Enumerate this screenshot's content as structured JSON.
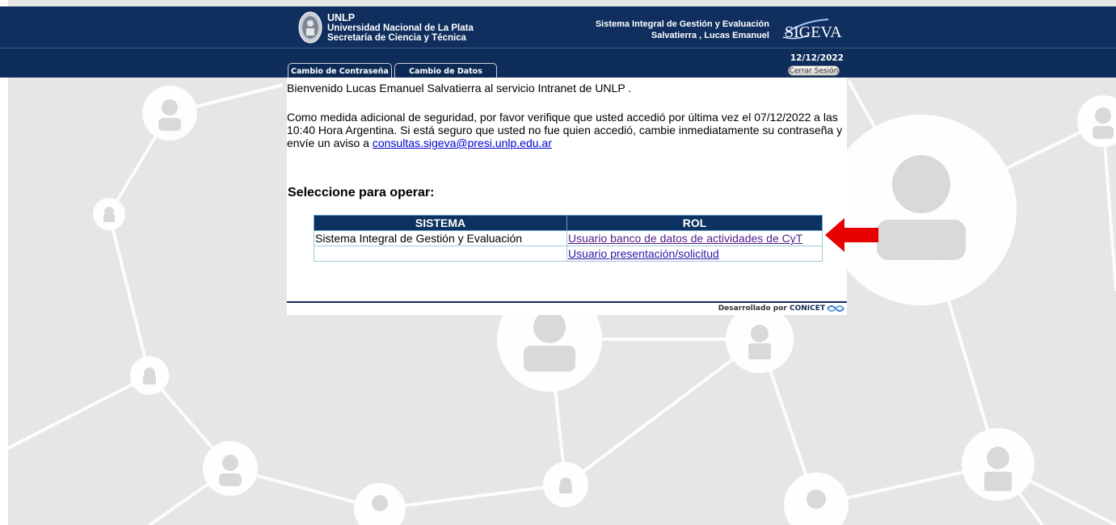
{
  "header": {
    "inst_abbr": "UNLP",
    "inst_name": "Universidad Nacional de La Plata",
    "inst_dept": "Secretaría de Ciencia y Técnica",
    "system_name": "Sistema Integral de Gestión y Evaluación",
    "user_name": "Salvatierra , Lucas Emanuel",
    "brand_logo_text": "SIGEVA",
    "date": "12/12/2022"
  },
  "nav": {
    "tabs": [
      {
        "label": "Cambio de Contraseña"
      },
      {
        "label": "Cambio de Datos"
      }
    ],
    "logout_label": "Cerrar Sesión"
  },
  "main": {
    "welcome": "Bienvenido Lucas Emanuel Salvatierra al servicio Intranet de UNLP .",
    "security_note": "Como medida adicional de seguridad, por favor verifique que usted accedió por última vez el 07/12/2022 a las 10:40 Hora Argentina. Si está seguro que usted no fue quien accedió, cambie inmediatamente su contraseña y envíe un aviso a",
    "contact_email": "consultas.sigeva@presi.unlp.edu.ar",
    "select_heading": "Seleccione para operar:",
    "table": {
      "headers": [
        "SISTEMA",
        "ROL"
      ],
      "rows": [
        {
          "system": "Sistema Integral de Gestión y Evaluación",
          "role": "Usuario banco de datos de actividades de CyT"
        },
        {
          "system": "",
          "role": "Usuario presentación/solicitud"
        }
      ]
    }
  },
  "footer": {
    "developed_by": "Desarrollado por",
    "org": "CONICET"
  },
  "colors": {
    "header_bg": "#102f5e",
    "table_header_bg": "#0b3260",
    "link": "#2a1aa8",
    "annotation_arrow": "#e60000"
  }
}
